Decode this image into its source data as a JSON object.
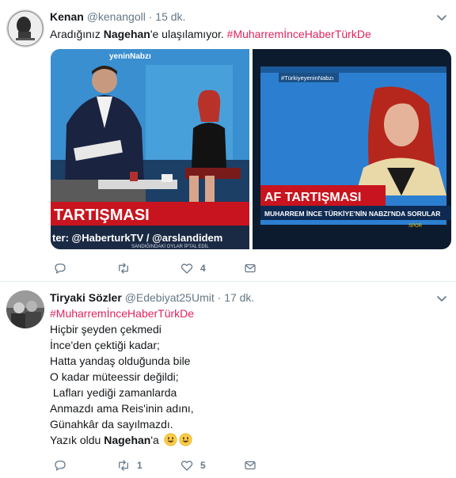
{
  "tweets": [
    {
      "name": "Kenan",
      "handle": "@kenangoll",
      "time": "15 dk.",
      "text_pre": "Aradığınız ",
      "text_bold": "Nagehan",
      "text_mid": "'e ulaşılamıyor. ",
      "hashtag": "#MuharremİnceHaberTürkDe",
      "media": {
        "left": {
          "banner": "TARTIŞMASI",
          "ticker": "ter: @HaberturkTV / @arslandidem",
          "ticker_small": "SANDIĞINDAKİ OYLAR İPTAL EDİL",
          "logo_text": "yeninNabzı"
        },
        "right": {
          "tag": "#TürkiyeyeninNabzı",
          "banner": "AF TARTIŞMASI",
          "ticker": "MUHARREM İNCE TÜRKİYE'NİN NABZI'NDA SORULAR",
          "sport": "SPOR"
        }
      },
      "stats": {
        "replies": "",
        "retweets": "",
        "likes": "4"
      }
    },
    {
      "name": "Tiryaki Sözler",
      "handle": "@Edebiyat25Umit",
      "time": "17 dk.",
      "hashtag": "#MuharremİnceHaberTürkDe",
      "lines": [
        "Hiçbir şeyden çekmedi",
        "İnce'den çektiği kadar;",
        "Hatta yandaş olduğunda bile",
        "O kadar müteessir değildi;",
        " Lafları yediği zamanlarda",
        "Anmazdı ama Reis'inin adını,",
        "Günahkâr da sayılmazdı."
      ],
      "last_pre": "Yazık oldu ",
      "last_bold": "Nagehan",
      "last_post": "'a",
      "stats": {
        "replies": "",
        "retweets": "1",
        "likes": "5"
      }
    }
  ],
  "colors": {
    "hashtag": "#e0245e",
    "secondary": "#657786",
    "banner_red": "#c8141e"
  },
  "icons": [
    "reply-icon",
    "retweet-icon",
    "like-icon",
    "dm-icon",
    "chevron-down-icon",
    "smiley-icon"
  ]
}
